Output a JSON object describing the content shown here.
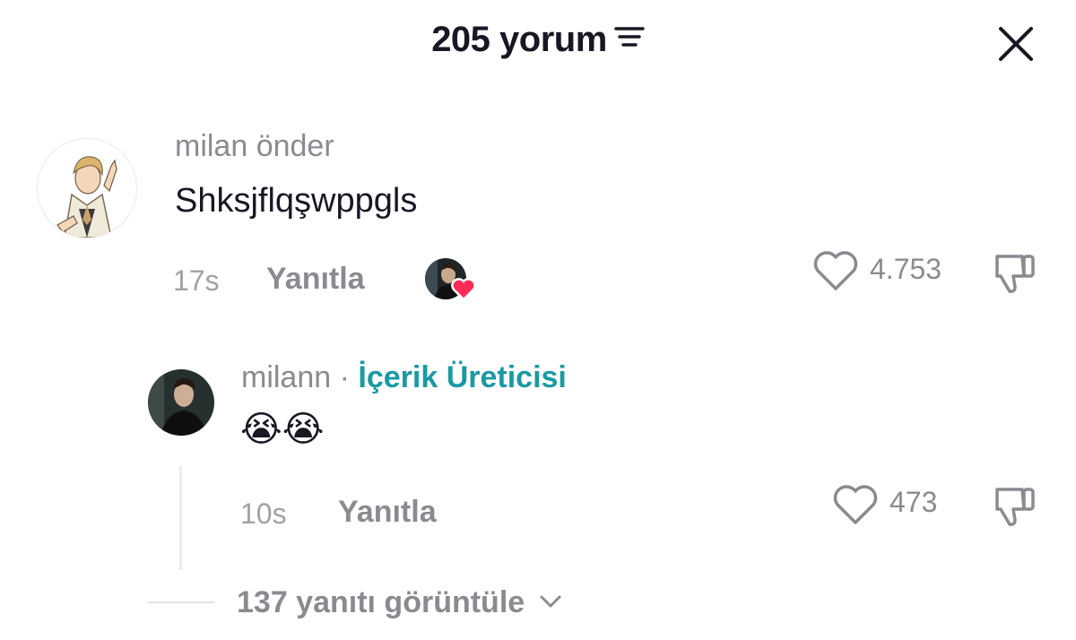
{
  "header": {
    "title": "205 yorum",
    "sort_icon": "sort-lines-icon",
    "close_icon": "close-icon"
  },
  "comment": {
    "username": "milan önder",
    "text": "Shksjflqşwppgls",
    "time": "17s",
    "reply_label": "Yanıtla",
    "like_count": "4.753",
    "creator_liked": true
  },
  "reply": {
    "username": "milann",
    "separator": "·",
    "creator_label": "İçerik Üreticisi",
    "text": "😭😭",
    "time": "10s",
    "reply_label": "Yanıtla",
    "like_count": "473"
  },
  "view_replies": {
    "label": "137 yanıtı görüntüle"
  },
  "colors": {
    "creator": "#1a9aa3",
    "heart_badge": "#fe2c55",
    "muted": "#8a8b91"
  }
}
